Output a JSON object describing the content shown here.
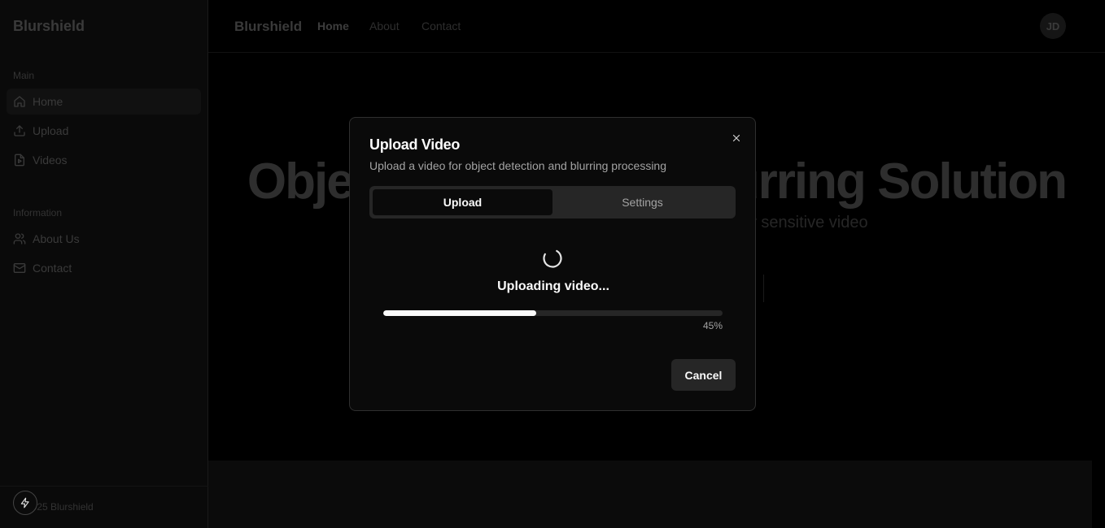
{
  "sidebar": {
    "brand": "Blurshield",
    "sections": {
      "main": "Main",
      "information": "Information"
    },
    "items": [
      {
        "label": "Home",
        "icon": "home-icon"
      },
      {
        "label": "Upload",
        "icon": "upload-icon"
      },
      {
        "label": "Videos",
        "icon": "video-file-icon"
      },
      {
        "label": "About Us",
        "icon": "users-icon"
      },
      {
        "label": "Contact",
        "icon": "mail-icon"
      }
    ],
    "footer": "2025 Blurshield"
  },
  "topbar": {
    "brand": "Blurshield",
    "links": [
      "Home",
      "About",
      "Contact"
    ],
    "avatar": "JD"
  },
  "hero": {
    "title": "Object Detection & Blurring Solution",
    "subtitle": "Automated object detection and blurring for sensitive video"
  },
  "modal": {
    "title": "Upload Video",
    "description": "Upload a video for object detection and blurring processing",
    "tabs": [
      "Upload",
      "Settings"
    ],
    "active_tab": "Upload",
    "status": "Uploading video...",
    "progress": 45,
    "progress_label": "45%",
    "cancel_label": "Cancel"
  },
  "colors": {
    "background": "#000000",
    "modal_bg": "#0a0a0a",
    "accent": "#fafafa",
    "muted": "#262626"
  }
}
